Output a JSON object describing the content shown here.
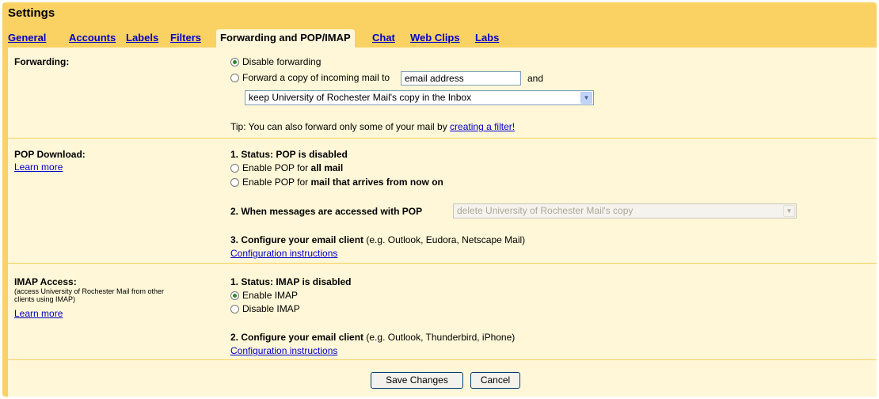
{
  "page": {
    "title": "Settings"
  },
  "tabs": [
    {
      "label": "General"
    },
    {
      "label": "Accounts"
    },
    {
      "label": "Labels"
    },
    {
      "label": "Filters"
    },
    {
      "label": "Forwarding and POP/IMAP",
      "active": true
    },
    {
      "label": "Chat"
    },
    {
      "label": "Web Clips"
    },
    {
      "label": "Labs"
    }
  ],
  "forwarding": {
    "label": "Forwarding:",
    "option_disable": "Disable forwarding",
    "option_forward_prefix": "Forward a copy of incoming mail to",
    "email_value": "email address",
    "and_text": "and",
    "action_select": "keep University of Rochester Mail's copy in the Inbox",
    "tip_prefix": "Tip: You can also forward only some of your mail by",
    "tip_link": "creating a filter!"
  },
  "pop": {
    "label": "POP Download:",
    "learn_more": "Learn more",
    "status": "1. Status: POP is disabled",
    "enable_all_prefix": "Enable POP for",
    "enable_all_bold": "all mail",
    "enable_new_prefix": "Enable POP for",
    "enable_new_bold": "mail that arrives from now on",
    "when_accessed": "2. When messages are accessed with POP",
    "when_select": "delete University of Rochester Mail's copy",
    "configure_bold": "3. Configure your email client",
    "configure_rest": "(e.g. Outlook, Eudora, Netscape Mail)",
    "config_link": "Configuration instructions"
  },
  "imap": {
    "label": "IMAP Access:",
    "note": "(access University of Rochester Mail from other clients using IMAP)",
    "learn_more": "Learn more",
    "status": "1. Status: IMAP is disabled",
    "enable": "Enable IMAP",
    "disable": "Disable IMAP",
    "configure_bold": "2. Configure your email client",
    "configure_rest": "(e.g. Outlook, Thunderbird, iPhone)",
    "config_link": "Configuration instructions"
  },
  "actions": {
    "save": "Save Changes",
    "cancel": "Cancel"
  }
}
